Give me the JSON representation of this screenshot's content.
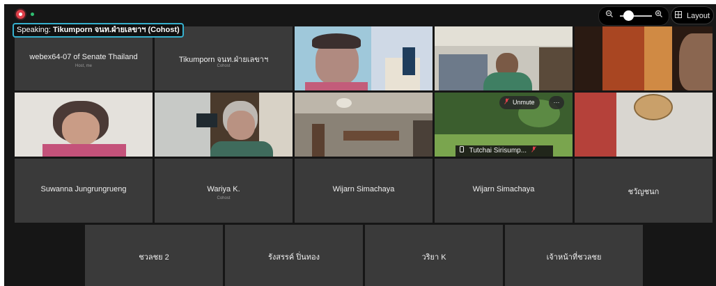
{
  "controls": {
    "zoom_out_icon": "zoom-out-icon",
    "zoom_in_icon": "zoom-in-icon",
    "zoom_level": 0.15,
    "layout_icon": "grid-layout-icon",
    "layout_label": "Layout"
  },
  "speaking": {
    "prefix": "Speaking:",
    "name": "Tikumporn จนท.ฝ่ายเลขาฯ (Cohost)"
  },
  "tiles": [
    {
      "name": "webex64-07 of  Senate Thailand",
      "role": "Host, me"
    },
    {
      "name": "Tikumporn จนท.ฝ่ายเลขาฯ",
      "role": "Cohost"
    },
    {
      "name": "Suwanna Jungrungrueng",
      "role": ""
    },
    {
      "name": "Wariya K.",
      "role": "Cohost"
    },
    {
      "name": "Wijarn Simachaya",
      "role": ""
    },
    {
      "name": "Wijarn Simachaya",
      "role": ""
    },
    {
      "name": "ชวัญชนก",
      "role": ""
    },
    {
      "name": "ชวลชย 2",
      "role": ""
    },
    {
      "name": "รังสรรค์ ปิ่นทอง",
      "role": ""
    },
    {
      "name": "วริยา K",
      "role": ""
    },
    {
      "name": "เจ้าหน้าที่ชวลชย",
      "role": ""
    }
  ],
  "video_tile": {
    "unmute_label": "Unmute",
    "more_label": "···",
    "name": "Tutchai Sirisump..."
  },
  "colors": {
    "record": "#e0404a",
    "speaking_border": "#36b1cf",
    "tile_bg": "#3a3a3a",
    "muted_mic": "#e0404a"
  }
}
